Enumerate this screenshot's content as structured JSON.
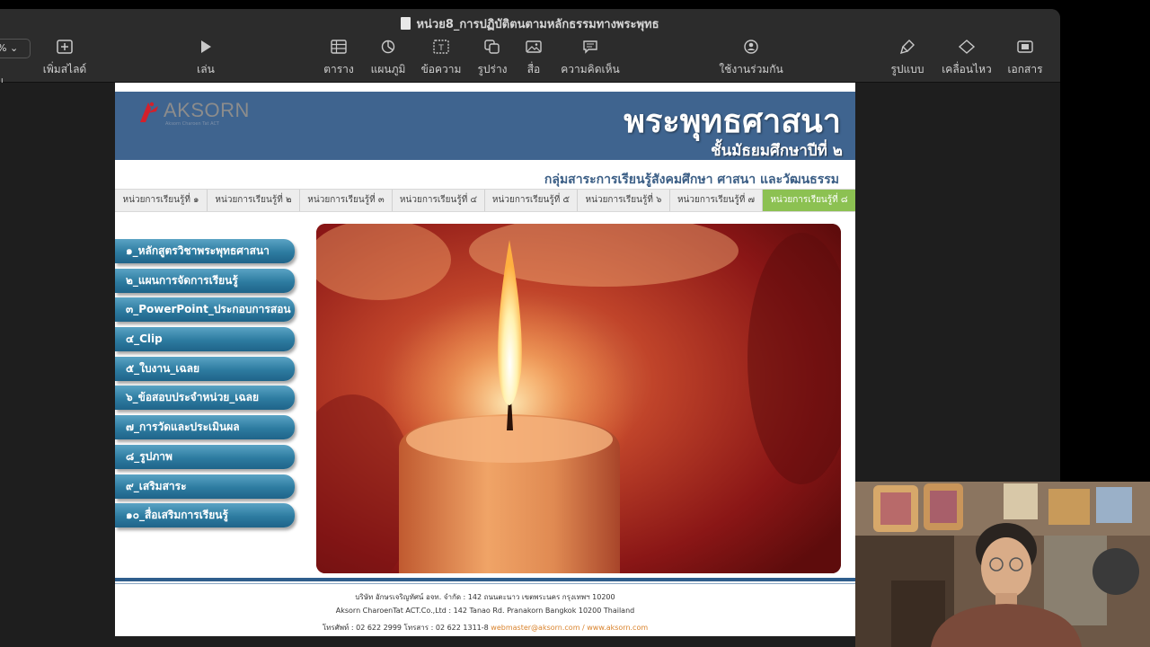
{
  "window": {
    "title": "หน่วย8_การปฏิบัติตนตามหลักธรรมทางพระพุทธ"
  },
  "toolbar": {
    "zoom_value": "%",
    "left_clipped_label": "ม",
    "add_slide_label": "เพิ่มสไลด์",
    "play_label": "เล่น",
    "table_label": "ตาราง",
    "chart_label": "แผนภูมิ",
    "text_label": "ข้อความ",
    "shape_label": "รูปร่าง",
    "media_label": "สื่อ",
    "comment_label": "ความคิดเห็น",
    "collaborate_label": "ใช้งานร่วมกัน",
    "format_label": "รูปแบบ",
    "animate_label": "เคลื่อนไหว",
    "document_label": "เอกสาร",
    "icons": [
      "add-slide-icon",
      "play-icon",
      "table-icon",
      "chart-icon",
      "text-icon",
      "shape-icon",
      "media-icon",
      "comment-icon",
      "collaborate-icon",
      "format-icon",
      "animate-icon",
      "document-icon"
    ]
  },
  "slide": {
    "logo_text": "AKSORN",
    "logo_subtext": "Aksorn Charoen Tat ACT",
    "title": "พระพุทธศาสนา",
    "subtitle": "ชั้นมัธยมศึกษาปีที่ ๒",
    "subject_group": "กลุ่มสาระการเรียนรู้สังคมศึกษา ศาสนา และวัฒนธรรม",
    "unit_tabs": [
      "หน่วยการเรียนรู้ที่ ๑",
      "หน่วยการเรียนรู้ที่ ๒",
      "หน่วยการเรียนรู้ที่ ๓",
      "หน่วยการเรียนรู้ที่ ๔",
      "หน่วยการเรียนรู้ที่ ๕",
      "หน่วยการเรียนรู้ที่ ๖",
      "หน่วยการเรียนรู้ที่ ๗",
      "หน่วยการเรียนรู้ที่ ๘"
    ],
    "active_tab_index": 7,
    "menu_items": [
      "๑_หลักสูตรวิชาพระพุทธศาสนา",
      "๒_แผนการจัดการเรียนรู้",
      "๓_PowerPoint_ประกอบการสอน",
      "๔_Clip",
      "๕_ใบงาน_เฉลย",
      "๖_ข้อสอบประจำหน่วย_เฉลย",
      "๗_การวัดและประเมินผล",
      "๘_รูปภาพ",
      "๙_เสริมสาระ",
      "๑๐_สื่อเสริมการเรียนรู้"
    ],
    "footer": {
      "line1": "บริษัท อักษรเจริญทัศน์ อจท. จำกัด : 142 ถนนตะนาว เขตพระนคร กรุงเทพฯ 10200",
      "line2": "Aksorn CharoenTat ACT.Co.,Ltd : 142 Tanao Rd. Pranakorn Bangkok 10200 Thailand",
      "line3_phone": "โทรศัพท์ : 02 622 2999  โทรสาร : 02 622 1311-8",
      "line3_links": "webmaster@aksorn.com / www.aksorn.com"
    }
  },
  "colors": {
    "banner": "#3f648f",
    "active_tab": "#8cc152",
    "menu_button": "#2d7ba0",
    "toolbar_bg": "#2c2c2c",
    "link": "#d9822b"
  }
}
